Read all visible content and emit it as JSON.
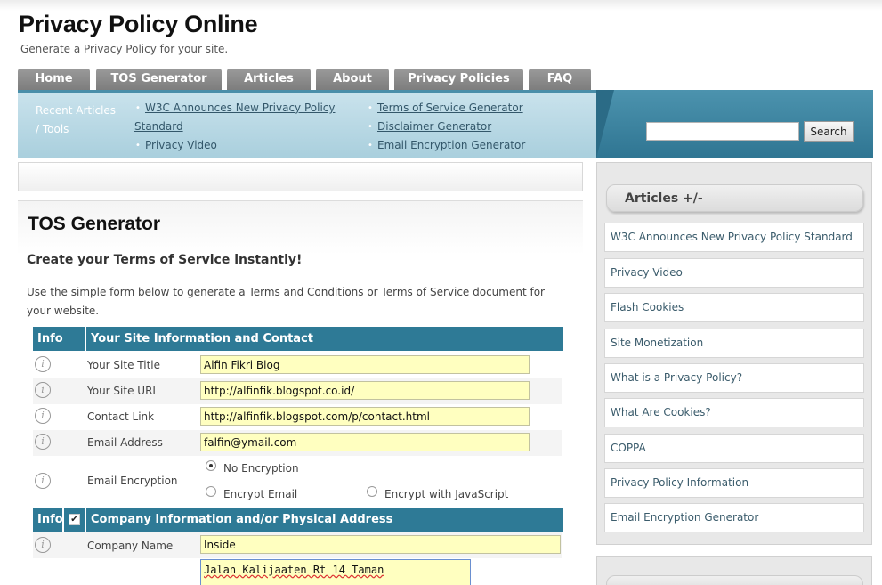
{
  "site": {
    "title": "Privacy Policy Online",
    "tagline": "Generate a Privacy Policy for your site."
  },
  "nav": {
    "tabs": [
      {
        "label": "Home"
      },
      {
        "label": "TOS Generator"
      },
      {
        "label": "Articles"
      },
      {
        "label": "About"
      },
      {
        "label": "Privacy Policies"
      },
      {
        "label": "FAQ"
      }
    ]
  },
  "recent": {
    "label_line1": "Recent Articles",
    "label_line2": "/ Tools",
    "links": [
      {
        "label": "W3C Announces New Privacy Policy"
      },
      {
        "label": "Standard"
      },
      {
        "label": "Privacy Video"
      },
      {
        "label": "Terms of Service Generator"
      },
      {
        "label": "Disclaimer Generator"
      },
      {
        "label": "Email Encryption Generator"
      }
    ]
  },
  "search": {
    "value": "",
    "button_label": "Search"
  },
  "main": {
    "title": "TOS Generator",
    "subheading": "Create your Terms of Service instantly!",
    "intro": "Use the simple form below to generate a Terms and Conditions or Terms of Service document for your website."
  },
  "form": {
    "info_label": "Info",
    "info_icon_glyph": "i",
    "section1_title": "Your Site Information and Contact",
    "fields": [
      {
        "label": "Your Site Title",
        "value": "Alfin Fikri Blog"
      },
      {
        "label": "Your Site URL",
        "value": "http://alfinfik.blogspot.co.id/"
      },
      {
        "label": "Contact Link",
        "value": "http://alfinfik.blogspot.com/p/contact.html"
      },
      {
        "label": "Email Address",
        "value": "falfin@ymail.com"
      }
    ],
    "encryption": {
      "label": "Email Encryption",
      "options": [
        {
          "label": "No Encryption",
          "selected": true
        },
        {
          "label": "Encrypt Email",
          "selected": false
        },
        {
          "label": "Encrypt with JavaScript",
          "selected": false
        }
      ]
    },
    "section2_title": "Company Information and/or Physical Address",
    "section2_checkbox_mark": "✔",
    "section2_checked": true,
    "company": {
      "label": "Company Name",
      "value": "Inside"
    },
    "address": {
      "value": "Jalan Kalijaaten Rt 14 Taman"
    }
  },
  "sidebar": {
    "heading": "Articles +/-",
    "items": [
      {
        "label": "W3C Announces New Privacy Policy Standard"
      },
      {
        "label": "Privacy Video"
      },
      {
        "label": "Flash Cookies"
      },
      {
        "label": "Site Monetization"
      },
      {
        "label": "What is a Privacy Policy?"
      },
      {
        "label": "What Are Cookies?"
      },
      {
        "label": "COPPA"
      },
      {
        "label": "Privacy Policy Information"
      },
      {
        "label": "Email Encryption Generator"
      }
    ]
  },
  "colors": {
    "accent": "#2e7a96",
    "input_bg": "#ffffc0",
    "nav_tab": "#8a8a8a"
  }
}
